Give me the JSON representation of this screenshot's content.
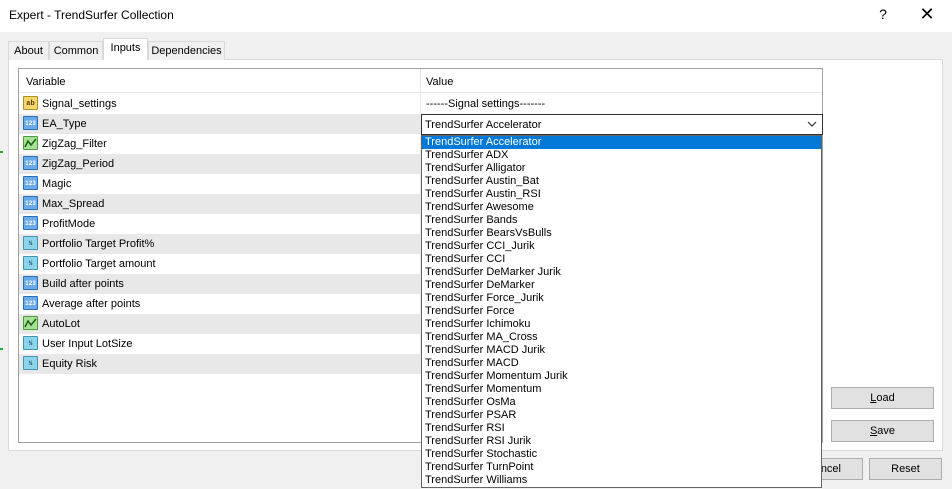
{
  "window": {
    "title": "Expert - TrendSurfer Collection",
    "help_glyph": "?",
    "close_glyph": "✕"
  },
  "tabs": [
    {
      "label": "About",
      "active": false
    },
    {
      "label": "Common",
      "active": false
    },
    {
      "label": "Inputs",
      "active": true
    },
    {
      "label": "Dependencies",
      "active": false
    }
  ],
  "grid": {
    "header": {
      "variable": "Variable",
      "value": "Value"
    },
    "rows": [
      {
        "icon": "ab-icon",
        "icon_text": "ab",
        "variable": "Signal_settings",
        "value": "------Signal settings-------"
      },
      {
        "icon": "number-icon",
        "icon_text": "123",
        "variable": "EA_Type",
        "value": ""
      },
      {
        "icon": "bool-icon",
        "icon_text": "",
        "variable": "ZigZag_Filter",
        "value": ""
      },
      {
        "icon": "number-icon",
        "icon_text": "123",
        "variable": "ZigZag_Period",
        "value": ""
      },
      {
        "icon": "number-icon",
        "icon_text": "123",
        "variable": "Magic",
        "value": ""
      },
      {
        "icon": "number-icon",
        "icon_text": "123",
        "variable": "Max_Spread",
        "value": ""
      },
      {
        "icon": "number-icon",
        "icon_text": "123",
        "variable": "ProfitMode",
        "value": ""
      },
      {
        "icon": "double-icon",
        "icon_text": "½",
        "variable": "Portfolio Target Profit%",
        "value": ""
      },
      {
        "icon": "double-icon",
        "icon_text": "½",
        "variable": "Portfolio Target amount",
        "value": ""
      },
      {
        "icon": "number-icon",
        "icon_text": "123",
        "variable": "Build after points",
        "value": ""
      },
      {
        "icon": "number-icon",
        "icon_text": "123",
        "variable": "Average after points",
        "value": ""
      },
      {
        "icon": "bool-icon",
        "icon_text": "",
        "variable": "AutoLot",
        "value": ""
      },
      {
        "icon": "double-icon",
        "icon_text": "½",
        "variable": "User Input LotSize",
        "value": ""
      },
      {
        "icon": "double-icon",
        "icon_text": "½",
        "variable": "Equity Risk",
        "value": ""
      }
    ]
  },
  "ea_type_select": {
    "selected": "TrendSurfer Accelerator",
    "options": [
      "TrendSurfer Accelerator",
      "TrendSurfer ADX",
      "TrendSurfer Alligator",
      "TrendSurfer Austin_Bat",
      "TrendSurfer Austin_RSI",
      "TrendSurfer Awesome",
      "TrendSurfer Bands",
      "TrendSurfer BearsVsBulls",
      "TrendSurfer CCI_Jurik",
      "TrendSurfer CCI",
      "TrendSurfer DeMarker Jurik",
      "TrendSurfer DeMarker",
      "TrendSurfer Force_Jurik",
      "TrendSurfer Force",
      "TrendSurfer Ichimoku",
      "TrendSurfer MA_Cross",
      "TrendSurfer MACD Jurik",
      "TrendSurfer MACD",
      "TrendSurfer Momentum Jurik",
      "TrendSurfer Momentum",
      "TrendSurfer OsMa",
      "TrendSurfer PSAR",
      "TrendSurfer RSI",
      "TrendSurfer RSI Jurik",
      "TrendSurfer Stochastic",
      "TrendSurfer TurnPoint",
      "TrendSurfer Williams"
    ]
  },
  "buttons": {
    "load": {
      "first": "L",
      "rest": "oad"
    },
    "save": {
      "first": "S",
      "rest": "ave"
    },
    "cancel_visible": "ncel",
    "reset": "Reset"
  },
  "colors": {
    "selection": "#0078d7",
    "row_shade": "#e8e8e8"
  }
}
